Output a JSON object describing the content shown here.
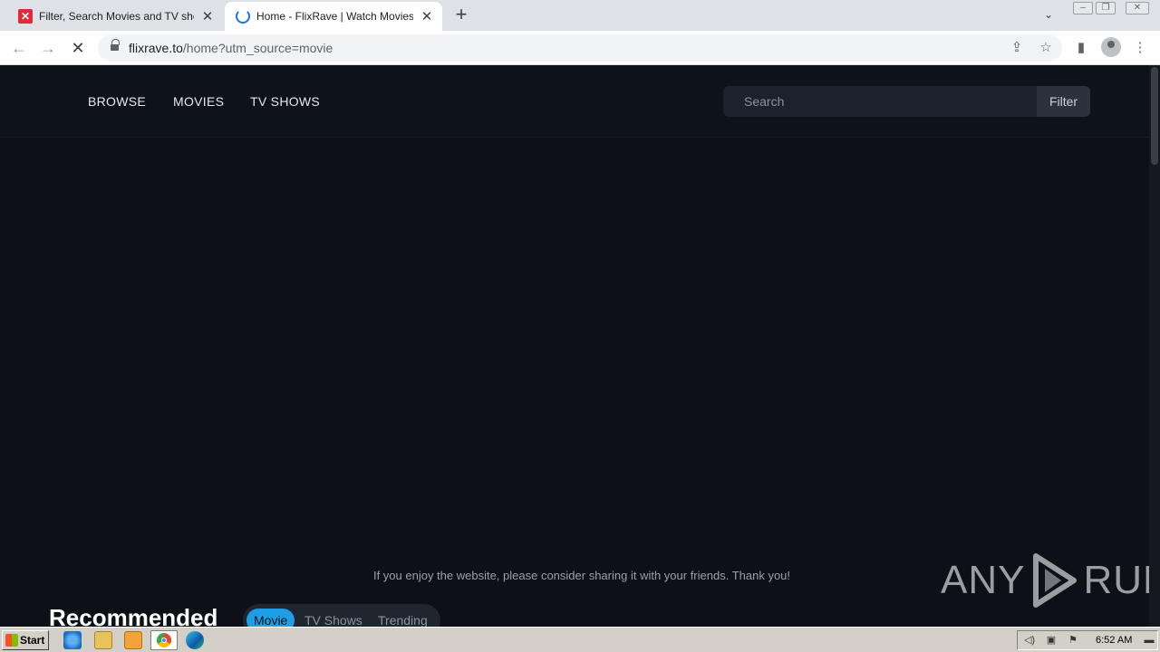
{
  "browser": {
    "tabs": [
      {
        "title": "Filter, Search Movies and TV shows -",
        "favicon": "flixrave-x-icon",
        "active": false
      },
      {
        "title": "Home - FlixRave | Watch Movies & T",
        "favicon": "loading-spinner-icon",
        "active": true
      }
    ],
    "new_tab_icon": "+",
    "tab_search_icon": "⌄",
    "window_controls": [
      "minimize",
      "restore",
      "close"
    ],
    "url_domain": "flixrave.to",
    "url_path": "/home?utm_source=movie",
    "toolbar_icons": [
      "share-icon",
      "star-icon",
      "sidepanel-icon",
      "profile-icon",
      "menu-icon"
    ]
  },
  "site": {
    "nav": {
      "browse": "BROWSE",
      "movies": "MOVIES",
      "tv_shows": "TV SHOWS"
    },
    "search": {
      "placeholder": "Search",
      "filter_label": "Filter"
    },
    "share_note": "If you enjoy the website, please consider sharing it with your friends. Thank you!",
    "recommended": {
      "title": "Recommended",
      "tabs": [
        "Movie",
        "TV Shows",
        "Trending"
      ],
      "active_tab": "Movie"
    },
    "accent_color": "#1e9ee6"
  },
  "watermark": {
    "left": "ANY",
    "right": "RUN"
  },
  "taskbar": {
    "start_label": "Start",
    "apps": [
      "ie-icon",
      "explorer-icon",
      "media-player-icon",
      "chrome-icon",
      "edge-icon"
    ],
    "clock": "6:52 AM"
  }
}
